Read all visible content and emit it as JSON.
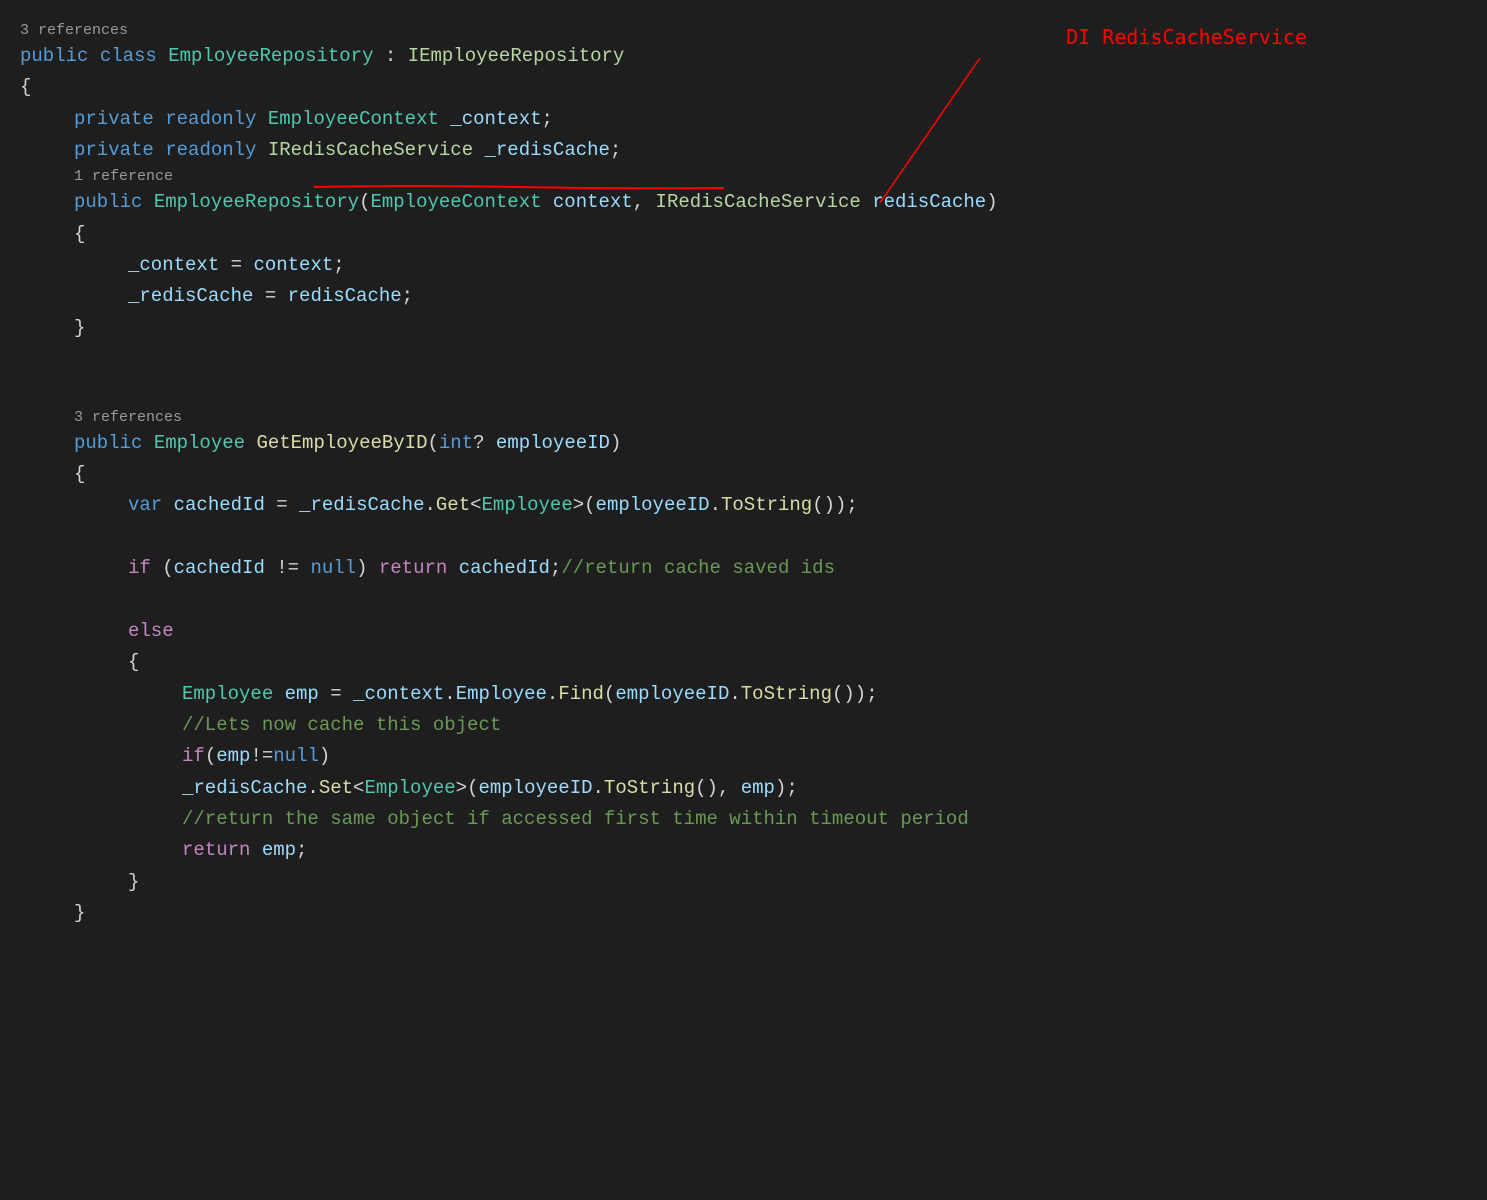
{
  "annotation": {
    "text": "DI RedisCacheService"
  },
  "codelens": {
    "ref1": "3 references",
    "ref2": "1 reference",
    "ref3": "3 references"
  },
  "lines": {
    "l1": {
      "t1": "public",
      "t2": " ",
      "t3": "class",
      "t4": " ",
      "t5": "EmployeeRepository",
      "t6": " : ",
      "t7": "IEmployeeRepository"
    },
    "l2": {
      "t1": "{"
    },
    "l3": {
      "t1": "private",
      "t2": " ",
      "t3": "readonly",
      "t4": " ",
      "t5": "EmployeeContext",
      "t6": " ",
      "t7": "_context",
      "t8": ";"
    },
    "l4": {
      "t1": "private",
      "t2": " ",
      "t3": "readonly",
      "t4": " ",
      "t5": "IRedisCacheService",
      "t6": " ",
      "t7": "_redisCache",
      "t8": ";"
    },
    "l5": {
      "t1": "public",
      "t2": " ",
      "t3": "EmployeeRepository",
      "t4": "(",
      "t5": "EmployeeContext",
      "t6": " ",
      "t7": "context",
      "t8": ", ",
      "t9": "IRedisCacheService",
      "t10": " ",
      "t11": "redisCache",
      "t12": ")"
    },
    "l6": {
      "t1": "{"
    },
    "l7": {
      "t1": "_context",
      "t2": " = ",
      "t3": "context",
      "t4": ";"
    },
    "l8": {
      "t1": "_redisCache",
      "t2": " = ",
      "t3": "redisCache",
      "t4": ";"
    },
    "l9": {
      "t1": "}"
    },
    "l10": {
      "t1": "public",
      "t2": " ",
      "t3": "Employee",
      "t4": " ",
      "t5": "GetEmployeeByID",
      "t6": "(",
      "t7": "int",
      "t8": "? ",
      "t9": "employeeID",
      "t10": ")"
    },
    "l11": {
      "t1": "{"
    },
    "l12": {
      "t1": "var",
      "t2": " ",
      "t3": "cachedId",
      "t4": " = ",
      "t5": "_redisCache",
      "t6": ".",
      "t7": "Get",
      "t8": "<",
      "t9": "Employee",
      "t10": ">(",
      "t11": "employeeID",
      "t12": ".",
      "t13": "ToString",
      "t14": "());"
    },
    "l13": {
      "t1": "if",
      "t2": " (",
      "t3": "cachedId",
      "t4": " != ",
      "t5": "null",
      "t6": ") ",
      "t7": "return",
      "t8": " ",
      "t9": "cachedId",
      "t10": ";",
      "t11": "//return cache saved ids"
    },
    "l14": {
      "t1": "else"
    },
    "l15": {
      "t1": "{"
    },
    "l16": {
      "t1": "Employee",
      "t2": " ",
      "t3": "emp",
      "t4": " = ",
      "t5": "_context",
      "t6": ".",
      "t7": "Employee",
      "t8": ".",
      "t9": "Find",
      "t10": "(",
      "t11": "employeeID",
      "t12": ".",
      "t13": "ToString",
      "t14": "());"
    },
    "l17": {
      "t1": "//Lets now cache this object"
    },
    "l18": {
      "t1": "if",
      "t2": "(",
      "t3": "emp",
      "t4": "!=",
      "t5": "null",
      "t6": ")"
    },
    "l19": {
      "t1": "_redisCache",
      "t2": ".",
      "t3": "Set",
      "t4": "<",
      "t5": "Employee",
      "t6": ">(",
      "t7": "employeeID",
      "t8": ".",
      "t9": "ToString",
      "t10": "(), ",
      "t11": "emp",
      "t12": ");"
    },
    "l20": {
      "t1": "//return the same object if accessed first time within timeout period"
    },
    "l21": {
      "t1": "return",
      "t2": " ",
      "t3": "emp",
      "t4": ";"
    },
    "l22": {
      "t1": "}"
    },
    "l23": {
      "t1": "}"
    }
  }
}
